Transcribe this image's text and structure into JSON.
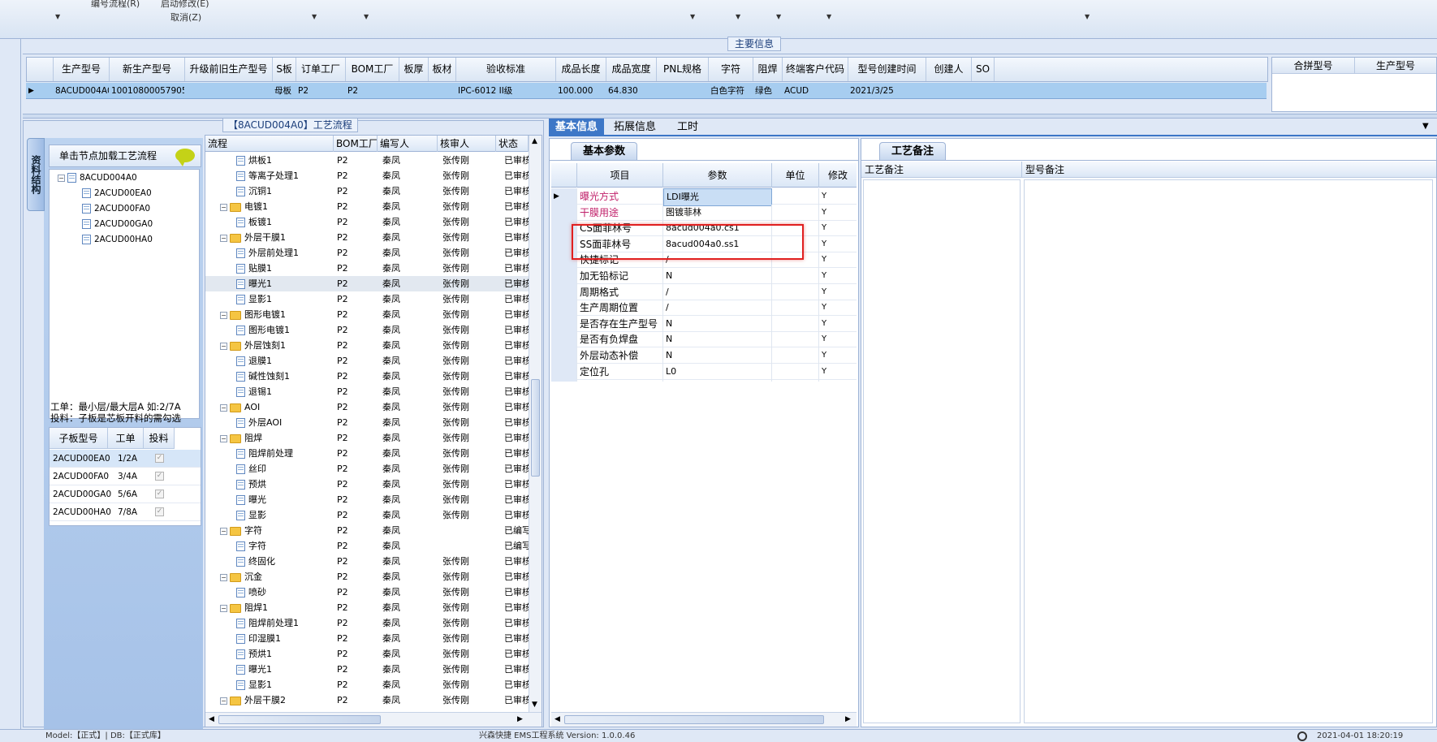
{
  "toolbar": {
    "item1": "编号流程(R)",
    "item2": "启动修改(E)",
    "item3": "取消(Z)"
  },
  "main_info": {
    "title": "主要信息",
    "columns": [
      "生产型号",
      "新生产型号",
      "升级前旧生产型号",
      "S板",
      "订单工厂",
      "BOM工厂",
      "板厚",
      "板材",
      "验收标准",
      "成品长度",
      "成品宽度",
      "PNL规格",
      "字符",
      "阻焊",
      "终端客户代码",
      "型号创建时间",
      "创建人",
      "SO"
    ],
    "row": [
      "8ACUD004A0",
      "10010800057905",
      "",
      "母板",
      "P2",
      "P2",
      "",
      "",
      "IPC-6012 II级",
      "100.000",
      "64.830",
      "",
      "白色字符",
      "绿色",
      "ACUD",
      "2021/3/25",
      "",
      ""
    ],
    "right_columns": [
      "合拼型号",
      "生产型号"
    ]
  },
  "process": {
    "title": "【8ACUD004A0】工艺流程",
    "vtab": "资料结构",
    "nav_header": "单击节点加载工艺流程",
    "tree": [
      {
        "label": "8ACUD004A0",
        "level": 0
      },
      {
        "label": "2ACUD00EA0",
        "level": 1
      },
      {
        "label": "2ACUD00FA0",
        "level": 1
      },
      {
        "label": "2ACUD00GA0",
        "level": 1
      },
      {
        "label": "2ACUD00HA0",
        "level": 1
      }
    ],
    "note_line1": "工单：最小层/最大层A 如:2/7A",
    "note_line2": "投料：子板是芯板开料的需勾选",
    "sub_columns": [
      "子板型号",
      "工单",
      "投料"
    ],
    "sub_rows": [
      {
        "model": "2ACUD00EA0",
        "order": "1/2A"
      },
      {
        "model": "2ACUD00FA0",
        "order": "3/4A"
      },
      {
        "model": "2ACUD00GA0",
        "order": "5/6A"
      },
      {
        "model": "2ACUD00HA0",
        "order": "7/8A"
      }
    ],
    "flow_columns": [
      "流程",
      "BOM工厂",
      "编写人",
      "核审人",
      "状态"
    ],
    "flow_rows": [
      {
        "name": "烘板1",
        "type": "doc",
        "factory": "P2",
        "writer": "秦凤",
        "reviewer": "张传刚",
        "status": "已审核"
      },
      {
        "name": "等离子处理1",
        "type": "doc",
        "factory": "P2",
        "writer": "秦凤",
        "reviewer": "张传刚",
        "status": "已审核"
      },
      {
        "name": "沉铜1",
        "type": "doc",
        "factory": "P2",
        "writer": "秦凤",
        "reviewer": "张传刚",
        "status": "已审核"
      },
      {
        "name": "电镀1",
        "type": "folder",
        "factory": "P2",
        "writer": "秦凤",
        "reviewer": "张传刚",
        "status": "已审核"
      },
      {
        "name": "板镀1",
        "type": "doc",
        "factory": "P2",
        "writer": "秦凤",
        "reviewer": "张传刚",
        "status": "已审核"
      },
      {
        "name": "外层干膜1",
        "type": "folder",
        "factory": "P2",
        "writer": "秦凤",
        "reviewer": "张传刚",
        "status": "已审核"
      },
      {
        "name": "外层前处理1",
        "type": "doc",
        "factory": "P2",
        "writer": "秦凤",
        "reviewer": "张传刚",
        "status": "已审核"
      },
      {
        "name": "贴膜1",
        "type": "doc",
        "factory": "P2",
        "writer": "秦凤",
        "reviewer": "张传刚",
        "status": "已审核"
      },
      {
        "name": "曝光1",
        "type": "doc",
        "factory": "P2",
        "writer": "秦凤",
        "reviewer": "张传刚",
        "status": "已审核"
      },
      {
        "name": "显影1",
        "type": "doc",
        "factory": "P2",
        "writer": "秦凤",
        "reviewer": "张传刚",
        "status": "已审核"
      },
      {
        "name": "图形电镀1",
        "type": "folder",
        "factory": "P2",
        "writer": "秦凤",
        "reviewer": "张传刚",
        "status": "已审核"
      },
      {
        "name": "图形电镀1",
        "type": "doc",
        "factory": "P2",
        "writer": "秦凤",
        "reviewer": "张传刚",
        "status": "已审核"
      },
      {
        "name": "外层蚀刻1",
        "type": "folder",
        "factory": "P2",
        "writer": "秦凤",
        "reviewer": "张传刚",
        "status": "已审核"
      },
      {
        "name": "退膜1",
        "type": "doc",
        "factory": "P2",
        "writer": "秦凤",
        "reviewer": "张传刚",
        "status": "已审核"
      },
      {
        "name": "碱性蚀刻1",
        "type": "doc",
        "factory": "P2",
        "writer": "秦凤",
        "reviewer": "张传刚",
        "status": "已审核"
      },
      {
        "name": "退锡1",
        "type": "doc",
        "factory": "P2",
        "writer": "秦凤",
        "reviewer": "张传刚",
        "status": "已审核"
      },
      {
        "name": "AOI",
        "type": "folder",
        "factory": "P2",
        "writer": "秦凤",
        "reviewer": "张传刚",
        "status": "已审核"
      },
      {
        "name": "外层AOI",
        "type": "doc",
        "factory": "P2",
        "writer": "秦凤",
        "reviewer": "张传刚",
        "status": "已审核"
      },
      {
        "name": "阻焊",
        "type": "folder",
        "factory": "P2",
        "writer": "秦凤",
        "reviewer": "张传刚",
        "status": "已审核"
      },
      {
        "name": "阻焊前处理",
        "type": "doc",
        "factory": "P2",
        "writer": "秦凤",
        "reviewer": "张传刚",
        "status": "已审核"
      },
      {
        "name": "丝印",
        "type": "doc",
        "factory": "P2",
        "writer": "秦凤",
        "reviewer": "张传刚",
        "status": "已审核"
      },
      {
        "name": "预烘",
        "type": "doc",
        "factory": "P2",
        "writer": "秦凤",
        "reviewer": "张传刚",
        "status": "已审核"
      },
      {
        "name": "曝光",
        "type": "doc",
        "factory": "P2",
        "writer": "秦凤",
        "reviewer": "张传刚",
        "status": "已审核"
      },
      {
        "name": "显影",
        "type": "doc",
        "factory": "P2",
        "writer": "秦凤",
        "reviewer": "张传刚",
        "status": "已审核"
      },
      {
        "name": "字符",
        "type": "folder",
        "factory": "P2",
        "writer": "秦凤",
        "reviewer": "",
        "status": "已编写"
      },
      {
        "name": "字符",
        "type": "doc",
        "factory": "P2",
        "writer": "秦凤",
        "reviewer": "",
        "status": "已编写"
      },
      {
        "name": "终固化",
        "type": "doc",
        "factory": "P2",
        "writer": "秦凤",
        "reviewer": "张传刚",
        "status": "已审核"
      },
      {
        "name": "沉金",
        "type": "folder",
        "factory": "P2",
        "writer": "秦凤",
        "reviewer": "张传刚",
        "status": "已审核"
      },
      {
        "name": "喷砂",
        "type": "doc",
        "factory": "P2",
        "writer": "秦凤",
        "reviewer": "张传刚",
        "status": "已审核"
      },
      {
        "name": "阻焊1",
        "type": "folder",
        "factory": "P2",
        "writer": "秦凤",
        "reviewer": "张传刚",
        "status": "已审核"
      },
      {
        "name": "阻焊前处理1",
        "type": "doc",
        "factory": "P2",
        "writer": "秦凤",
        "reviewer": "张传刚",
        "status": "已审核"
      },
      {
        "name": "印湿膜1",
        "type": "doc",
        "factory": "P2",
        "writer": "秦凤",
        "reviewer": "张传刚",
        "status": "已审核"
      },
      {
        "name": "预烘1",
        "type": "doc",
        "factory": "P2",
        "writer": "秦凤",
        "reviewer": "张传刚",
        "status": "已审核"
      },
      {
        "name": "曝光1",
        "type": "doc",
        "factory": "P2",
        "writer": "秦凤",
        "reviewer": "张传刚",
        "status": "已审核"
      },
      {
        "name": "显影1",
        "type": "doc",
        "factory": "P2",
        "writer": "秦凤",
        "reviewer": "张传刚",
        "status": "已审核"
      },
      {
        "name": "外层干膜2",
        "type": "folder",
        "factory": "P2",
        "writer": "秦凤",
        "reviewer": "张传刚",
        "status": "已审核"
      }
    ]
  },
  "tabs": [
    "基本信息",
    "拓展信息",
    "工时"
  ],
  "basic": {
    "subtab": "基本参数",
    "columns": [
      "项目",
      "参数",
      "单位",
      "修改"
    ],
    "rows": [
      {
        "item": "曝光方式",
        "param": "LDI曝光",
        "unit": "",
        "mod": "Y",
        "pink": true
      },
      {
        "item": "干膜用途",
        "param": "图镀菲林",
        "unit": "",
        "mod": "Y",
        "pink": true
      },
      {
        "item": "CS面菲林号",
        "param": "8acud004a0.cs1",
        "unit": "",
        "mod": "Y",
        "pink": false
      },
      {
        "item": "SS面菲林号",
        "param": "8acud004a0.ss1",
        "unit": "",
        "mod": "Y",
        "pink": false
      },
      {
        "item": "快捷标记",
        "param": "/",
        "unit": "",
        "mod": "Y",
        "pink": false
      },
      {
        "item": "加无铅标记",
        "param": "N",
        "unit": "",
        "mod": "Y",
        "pink": false
      },
      {
        "item": "周期格式",
        "param": "/",
        "unit": "",
        "mod": "Y",
        "pink": false
      },
      {
        "item": "生产周期位置",
        "param": "/",
        "unit": "",
        "mod": "Y",
        "pink": false
      },
      {
        "item": "是否存在生产型号",
        "param": "N",
        "unit": "",
        "mod": "Y",
        "pink": false
      },
      {
        "item": "是否有负焊盘",
        "param": "N",
        "unit": "",
        "mod": "Y",
        "pink": false
      },
      {
        "item": "外层动态补偿",
        "param": "N",
        "unit": "",
        "mod": "Y",
        "pink": false
      },
      {
        "item": "定位孔",
        "param": "L0",
        "unit": "",
        "mod": "Y",
        "pink": false
      }
    ]
  },
  "remarks": {
    "subtab": "工艺备注",
    "col1": "工艺备注",
    "col2": "型号备注"
  },
  "status": {
    "left": "Model:【正式】| DB:【正式库】",
    "center": "兴森快捷 EMS工程系统 Version: 1.0.0.46",
    "time": "2021-04-01 18:20:19"
  },
  "colors": {
    "accent": "#3d77c7",
    "selected_row": "#a7cdf0",
    "pink_text": "#c0206a",
    "highlight_box": "#e02020"
  }
}
